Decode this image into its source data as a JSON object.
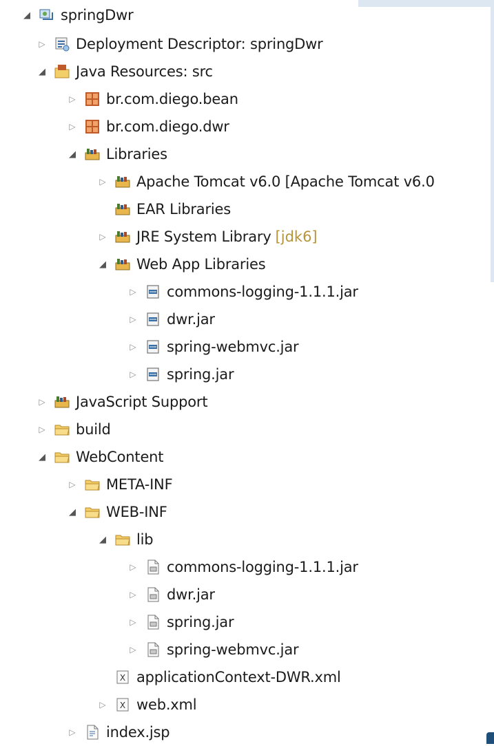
{
  "window": {
    "title": "springDwr"
  },
  "tree": {
    "project": {
      "label": "springDwr",
      "icon": "web-project-icon",
      "expanded": true
    },
    "deployment_descriptor": {
      "label": "Deployment Descriptor: springDwr",
      "icon": "deployment-descriptor-icon"
    },
    "java_resources": {
      "label": "Java Resources: src",
      "icon": "java-resources-icon",
      "expanded": true
    },
    "packages": [
      {
        "label": "br.com.diego.bean",
        "icon": "package-icon"
      },
      {
        "label": "br.com.diego.dwr",
        "icon": "package-icon"
      }
    ],
    "libraries": {
      "label": "Libraries",
      "icon": "library-icon",
      "expanded": true
    },
    "library_items": [
      {
        "label": "Apache Tomcat v6.0 [Apache Tomcat v6.0",
        "icon": "library-icon"
      },
      {
        "label": "EAR Libraries",
        "icon": "library-icon"
      },
      {
        "label": "JRE System Library",
        "decoration": "[jdk6]",
        "icon": "library-icon"
      },
      {
        "label": "Web App Libraries",
        "icon": "library-icon",
        "expanded": true
      }
    ],
    "web_app_jars": [
      {
        "label": "commons-logging-1.1.1.jar",
        "icon": "jar-icon"
      },
      {
        "label": "dwr.jar",
        "icon": "jar-icon"
      },
      {
        "label": "spring-webmvc.jar",
        "icon": "jar-icon"
      },
      {
        "label": "spring.jar",
        "icon": "jar-icon"
      }
    ],
    "javascript_support": {
      "label": "JavaScript Support",
      "icon": "library-icon"
    },
    "build": {
      "label": "build",
      "icon": "folder-icon"
    },
    "webcontent": {
      "label": "WebContent",
      "icon": "folder-icon",
      "expanded": true
    },
    "meta_inf": {
      "label": "META-INF",
      "icon": "folder-icon"
    },
    "web_inf": {
      "label": "WEB-INF",
      "icon": "folder-icon",
      "expanded": true
    },
    "lib": {
      "label": "lib",
      "icon": "folder-icon",
      "expanded": true
    },
    "lib_jars": [
      {
        "label": "commons-logging-1.1.1.jar",
        "icon": "jar-file-icon"
      },
      {
        "label": "dwr.jar",
        "icon": "jar-file-icon"
      },
      {
        "label": "spring.jar",
        "icon": "jar-file-icon"
      },
      {
        "label": "spring-webmvc.jar",
        "icon": "jar-file-icon"
      }
    ],
    "application_context": {
      "label": "applicationContext-DWR.xml",
      "icon": "xml-file-icon"
    },
    "web_xml": {
      "label": "web.xml",
      "icon": "xml-file-icon"
    },
    "index_jsp": {
      "label": "index.jsp",
      "icon": "jsp-file-icon"
    }
  },
  "colors": {
    "folder": "#e8b64a",
    "package": "#c05a2a",
    "library": "#b88a2a",
    "decoration": "#b8933a",
    "frame": "#dce7f1"
  }
}
